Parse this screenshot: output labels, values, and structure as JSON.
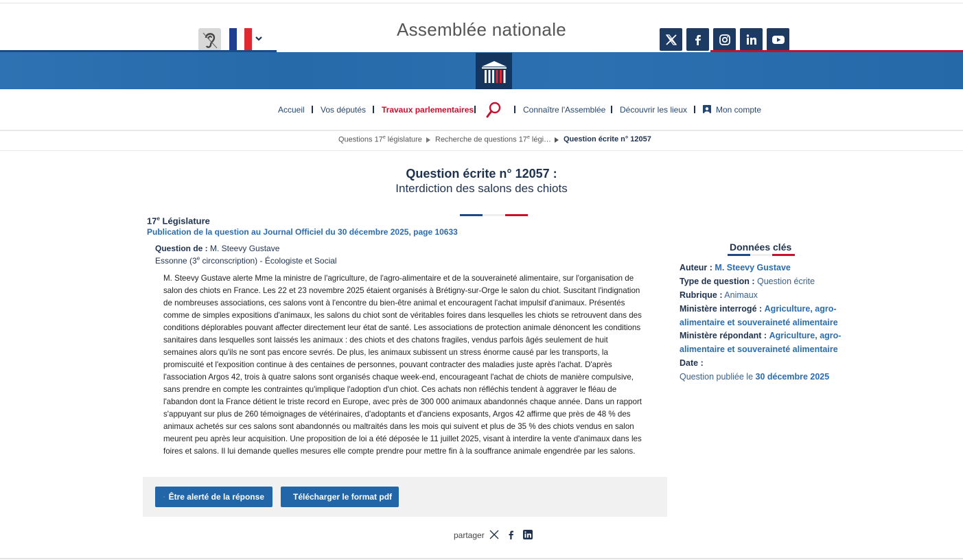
{
  "header": {
    "site_title": "Assemblée nationale"
  },
  "nav": {
    "items": [
      {
        "label": "Accueil"
      },
      {
        "label": "Vos députés"
      },
      {
        "label": "Travaux parlementaires"
      },
      {
        "label": "Connaître l'Assemblée"
      },
      {
        "label": "Découvrir les lieux"
      },
      {
        "label": "Mon compte"
      }
    ]
  },
  "breadcrumb": {
    "item1": "Questions 17",
    "item1_sup": "e",
    "item1_tail": " législature",
    "item2": "Recherche de questions 17",
    "item2_sup": "e",
    "item2_tail": " légi…",
    "current": "Question écrite n° 12057"
  },
  "question": {
    "title": "Question écrite n° 12057 :",
    "subtitle": "Interdiction des salons des chiots",
    "legislature_num": "17",
    "legislature_sup": "e",
    "legislature_label": " Législature",
    "publication": "Publication de la question au Journal Officiel du 30 décembre 2025, page 10633",
    "asker_label": "Question de :",
    "asker_name": " M. Steevy Gustave",
    "circ_pre": "Essonne (3",
    "circ_sup": "e",
    "circ_post": " circonscription) - Écologiste et Social",
    "text": "M. Steevy Gustave alerte Mme la ministre de l'agriculture, de l'agro-alimentaire et de la souveraineté alimentaire, sur l'organisation de salon des chiots en France. Les 22 et 23 novembre 2025 étaient organisés à Brétigny-sur-Orge le salon du chiot. Suscitant l'indignation de nombreuses associations, ces salons vont à l'encontre du bien-être animal et encouragent l'achat impulsif d'animaux. Présentés comme de simples expositions d'animaux, les salons du chiot sont de véritables foires dans lesquelles les chiots se retrouvent dans des conditions déplorables pouvant affecter directement leur état de santé. Les associations de protection animale dénoncent les conditions sanitaires dans lesquelles sont laissés les animaux : des chiots et des chatons fragiles, vendus parfois âgés seulement de huit semaines alors qu'ils ne sont pas encore sevrés. De plus, les animaux subissent un stress énorme causé par les transports, la promiscuité et l'exposition continue à des centaines de personnes, pouvant contracter des maladies juste après l'achat. D'après l'association Argos 42, trois à quatre salons sont organisés chaque week-end, encourageant l'achat de chiots de manière compulsive, sans prendre en compte les contraintes qu'implique l'adoption d'un chiot. Ces achats non réfléchis tendent à aggraver le fléau de l'abandon dont la France détient le triste record en Europe, avec près de 300 000 animaux abandonnés chaque année. Dans un rapport s'appuyant sur plus de 260 témoignages de vétérinaires, d'adoptants et d'anciens exposants, Argos 42 affirme que près de 48 % des animaux achetés sur ces salons sont abandonnés ou maltraités dans les mois qui suivent et plus de 35 % des chiots vendus en salon meurent peu après leur acquisition. Une proposition de loi a été déposée le 11 juillet 2025, visant à interdire la vente d'animaux dans les foires et salons. Il lui demande quelles mesures elle compte prendre pour mettre fin à la souffrance animale engendrée par les salons."
  },
  "actions": {
    "alert_label": "Être alerté de la réponse",
    "pdf_label": "Télécharger le format pdf"
  },
  "share": {
    "label": "partager"
  },
  "key_data": {
    "title": "Données clés",
    "author_label": "Auteur :",
    "author_value": "M. Steevy Gustave",
    "type_label": "Type de question :",
    "type_value": "Question écrite",
    "rubrique_label": "Rubrique :",
    "rubrique_value": "Animaux",
    "ministere_interroge_label": "Ministère interrogé :",
    "ministere_interroge_line1": "Agriculture, agro-",
    "ministere_interroge_line2": "alimentaire et souveraineté alimentaire",
    "ministere_repondant_label": "Ministère répondant :",
    "ministere_repondant_line1": "Agriculture, agro-",
    "ministere_repondant_line2": "alimentaire et souveraineté alimentaire",
    "date_label": "Date :",
    "date_prefix": "Question publiée le ",
    "date_value": "30 décembre 2025"
  },
  "colors": {
    "navy": "#1e3250",
    "link_blue": "#2a6cb0",
    "red": "#c8102e",
    "button_blue": "#2266a8",
    "banner_blue": "#2a6fb0"
  },
  "icons": [
    "ear-icon",
    "french-flag-icon",
    "chevron-down-icon",
    "x-icon",
    "facebook-icon",
    "instagram-icon",
    "linkedin-icon",
    "youtube-icon",
    "assemblee-logo",
    "search-icon",
    "account-icon",
    "broadcast-icon",
    "pdf-icon"
  ]
}
